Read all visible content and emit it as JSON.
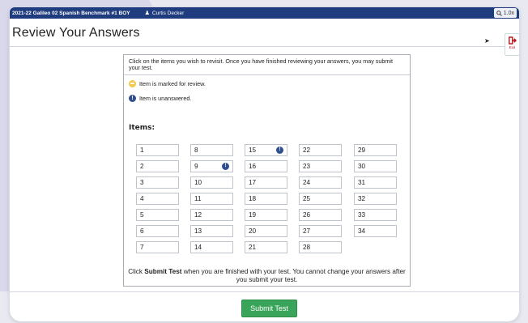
{
  "topbar": {
    "test_title": "2021-22 Galileo 02 Spanish Benchmark #1 BOY",
    "user_name": "Curtis Decker",
    "zoom": "1.0x"
  },
  "header": {
    "title": "Review Your Answers",
    "exit_label": "Exit"
  },
  "panel": {
    "instructions": "Click on the items you wish to revisit. Once you have finished reviewing your answers, you may submit your test.",
    "legend": [
      {
        "icon": "marked-for-review-icon",
        "text": "Item is marked for review."
      },
      {
        "icon": "unanswered-icon",
        "text": "Item is unanswered."
      }
    ],
    "items_label": "Items:",
    "items": [
      {
        "number": "1",
        "unanswered": false
      },
      {
        "number": "2",
        "unanswered": false
      },
      {
        "number": "3",
        "unanswered": false
      },
      {
        "number": "4",
        "unanswered": false
      },
      {
        "number": "5",
        "unanswered": false
      },
      {
        "number": "6",
        "unanswered": false
      },
      {
        "number": "7",
        "unanswered": false
      },
      {
        "number": "8",
        "unanswered": false
      },
      {
        "number": "9",
        "unanswered": true
      },
      {
        "number": "10",
        "unanswered": false
      },
      {
        "number": "11",
        "unanswered": false
      },
      {
        "number": "12",
        "unanswered": false
      },
      {
        "number": "13",
        "unanswered": false
      },
      {
        "number": "14",
        "unanswered": false
      },
      {
        "number": "15",
        "unanswered": true
      },
      {
        "number": "16",
        "unanswered": false
      },
      {
        "number": "17",
        "unanswered": false
      },
      {
        "number": "18",
        "unanswered": false
      },
      {
        "number": "19",
        "unanswered": false
      },
      {
        "number": "20",
        "unanswered": false
      },
      {
        "number": "21",
        "unanswered": false
      },
      {
        "number": "22",
        "unanswered": false
      },
      {
        "number": "23",
        "unanswered": false
      },
      {
        "number": "24",
        "unanswered": false
      },
      {
        "number": "25",
        "unanswered": false
      },
      {
        "number": "26",
        "unanswered": false
      },
      {
        "number": "27",
        "unanswered": false
      },
      {
        "number": "28",
        "unanswered": false
      },
      {
        "number": "29",
        "unanswered": false
      },
      {
        "number": "30",
        "unanswered": false
      },
      {
        "number": "31",
        "unanswered": false
      },
      {
        "number": "32",
        "unanswered": false
      },
      {
        "number": "33",
        "unanswered": false
      },
      {
        "number": "34",
        "unanswered": false
      }
    ],
    "footer_pre": "Click ",
    "footer_bold": "Submit Test",
    "footer_post": " when you are finished with your test. You cannot change your answers after you submit your test."
  },
  "submit": {
    "label": "Submit Test"
  },
  "colors": {
    "topbar": "#1f3c7e",
    "submit": "#3aa45a",
    "unanswered": "#2f4f8f",
    "review": "#f2c94c"
  }
}
